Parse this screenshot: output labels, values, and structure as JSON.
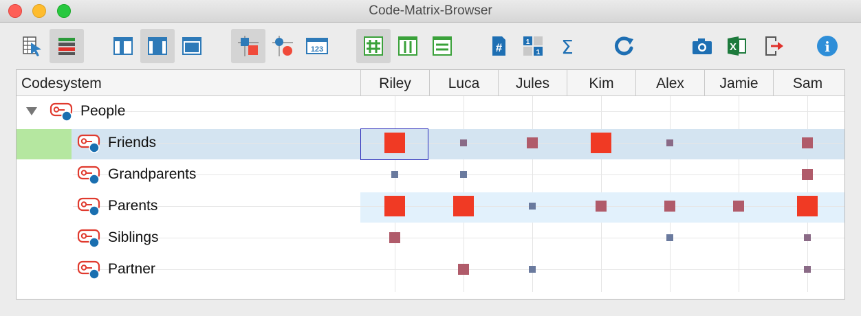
{
  "window": {
    "title": "Code-Matrix-Browser"
  },
  "toolbar": {
    "buttons": [
      {
        "name": "select-documents-button",
        "icon": "document-select-icon",
        "active": false
      },
      {
        "name": "select-codes-button",
        "icon": "code-select-icon",
        "active": true
      },
      {
        "name": "view-left-button",
        "icon": "panel-left-icon",
        "active": false
      },
      {
        "name": "view-center-button",
        "icon": "panel-center-icon",
        "active": true
      },
      {
        "name": "view-full-button",
        "icon": "panel-full-icon",
        "active": false
      },
      {
        "name": "symbols-squares-button",
        "icon": "squares-icon",
        "active": true
      },
      {
        "name": "symbols-circles-button",
        "icon": "circles-icon",
        "active": false
      },
      {
        "name": "symbols-numbers-button",
        "icon": "numbers-icon",
        "active": false
      },
      {
        "name": "grid-button",
        "icon": "grid-icon",
        "active": true
      },
      {
        "name": "columns-button",
        "icon": "columns-icon",
        "active": false
      },
      {
        "name": "rows-button",
        "icon": "rows-icon",
        "active": false
      },
      {
        "name": "count-hits-button",
        "icon": "hash-document-icon",
        "active": false
      },
      {
        "name": "binary-button",
        "icon": "binary-icon",
        "active": false
      },
      {
        "name": "sum-button",
        "icon": "sigma-icon",
        "active": false
      },
      {
        "name": "refresh-button",
        "icon": "refresh-icon",
        "active": false
      },
      {
        "name": "screenshot-button",
        "icon": "camera-icon",
        "active": false
      },
      {
        "name": "excel-export-button",
        "icon": "excel-icon",
        "active": false
      },
      {
        "name": "export-button",
        "icon": "export-icon",
        "active": false
      },
      {
        "name": "info-button",
        "icon": "info-icon",
        "active": false
      }
    ],
    "numbers_icon_text": "123",
    "hash_icon_text": "#",
    "sigma_icon_text": "Σ",
    "excel_icon_text": "X",
    "info_icon_text": "i",
    "binary_icon_text": "1"
  },
  "matrix": {
    "header_label": "Codesystem",
    "documents": [
      "Riley",
      "Luca",
      "Jules",
      "Kim",
      "Alex",
      "Jamie",
      "Sam"
    ],
    "rows": [
      {
        "label": "People",
        "level": 0,
        "expanded": true,
        "cells": [
          0,
          0,
          0,
          0,
          0,
          0,
          0
        ]
      },
      {
        "label": "Friends",
        "level": 1,
        "selected": true,
        "cells": [
          3,
          1,
          2,
          3,
          1,
          0,
          2
        ]
      },
      {
        "label": "Grandparents",
        "level": 1,
        "cells": [
          1,
          1,
          0,
          0,
          0,
          0,
          2
        ]
      },
      {
        "label": "Parents",
        "level": 1,
        "highlighted": true,
        "cells": [
          3,
          3,
          1,
          2,
          2,
          2,
          3
        ]
      },
      {
        "label": "Siblings",
        "level": 1,
        "cells": [
          2,
          0,
          0,
          0,
          1,
          0,
          1
        ]
      },
      {
        "label": "Partner",
        "level": 1,
        "cells": [
          0,
          2,
          1,
          0,
          0,
          0,
          1
        ]
      }
    ],
    "selected_cell": {
      "row": 1,
      "col": 0
    },
    "symbol_colors": {
      "1": "#6a7a9e",
      "2": "#b05b6a",
      "3": "#f03a24"
    },
    "small_colors": {
      "1a": "#9c6f86"
    },
    "code_icon_color": "#e03a2e",
    "code_icon_dot_color": "#1a6fb0"
  }
}
